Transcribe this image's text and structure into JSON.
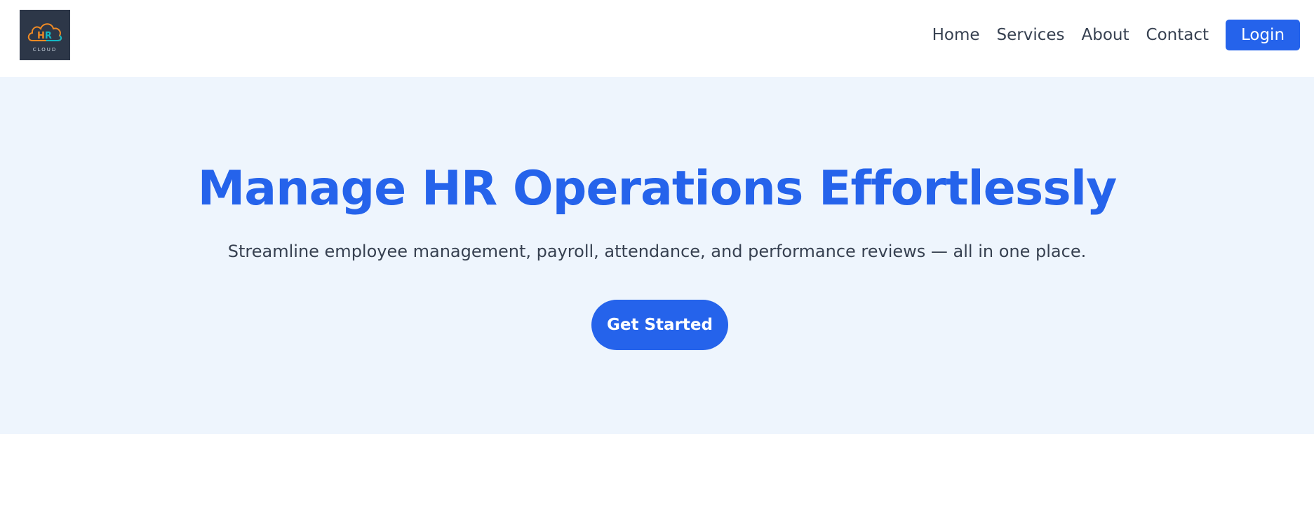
{
  "header": {
    "logo": {
      "text_main": "HR",
      "text_sub": "CLOUD",
      "colors": {
        "h": "#f08a24",
        "r": "#14b8c4",
        "background": "#2d3748"
      }
    },
    "nav": {
      "items": [
        {
          "label": "Home"
        },
        {
          "label": "Services"
        },
        {
          "label": "About"
        },
        {
          "label": "Contact"
        }
      ],
      "login_label": "Login"
    }
  },
  "hero": {
    "title": "Manage HR Operations Effortlessly",
    "subtitle": "Streamline employee management, payroll, attendance, and performance reviews — all in one place.",
    "cta_label": "Get Started"
  },
  "colors": {
    "accent": "#2563eb",
    "hero_bg": "#eef5fd",
    "text": "#374151"
  }
}
